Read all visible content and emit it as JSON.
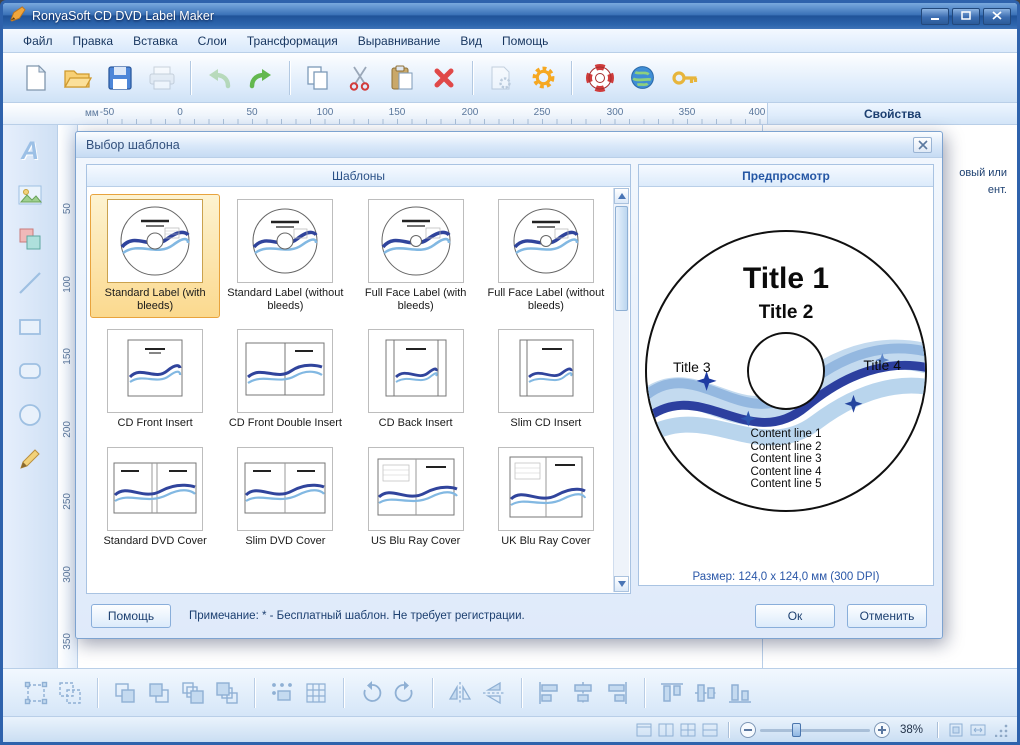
{
  "window": {
    "title": "RonyaSoft CD DVD Label Maker"
  },
  "menu": {
    "items": [
      "Файл",
      "Правка",
      "Вставка",
      "Слои",
      "Трансформация",
      "Выравнивание",
      "Вид",
      "Помощь"
    ]
  },
  "ruler": {
    "unit": "мм",
    "h_ticks": [
      "-50",
      "0",
      "50",
      "100",
      "150",
      "200",
      "250",
      "300",
      "350",
      "400"
    ],
    "v_ticks": [
      "50",
      "100",
      "150",
      "200",
      "250",
      "300",
      "350"
    ]
  },
  "properties": {
    "title": "Свойства",
    "visible_fragments": [
      "овый или",
      "ент."
    ]
  },
  "tools": {
    "text_tool_glyph": "A"
  },
  "dialog": {
    "title": "Выбор шаблона",
    "templates_header": "Шаблоны",
    "preview_header": "Предпросмотр",
    "templates": [
      {
        "label": "Standard Label (with bleeds)",
        "selected": true
      },
      {
        "label": "Standard Label (without bleeds)",
        "selected": false
      },
      {
        "label": "Full Face Label (with bleeds)",
        "selected": false
      },
      {
        "label": "Full Face Label (without bleeds)",
        "selected": false
      },
      {
        "label": "CD Front Insert",
        "selected": false
      },
      {
        "label": "CD Front Double Insert",
        "selected": false
      },
      {
        "label": "CD Back Insert",
        "selected": false
      },
      {
        "label": "Slim CD Insert",
        "selected": false
      },
      {
        "label": "Standard DVD Cover",
        "selected": false
      },
      {
        "label": "Slim DVD Cover",
        "selected": false
      },
      {
        "label": "US Blu Ray Cover",
        "selected": false
      },
      {
        "label": "UK Blu Ray Cover",
        "selected": false
      }
    ],
    "preview": {
      "title1": "Title 1",
      "title2": "Title 2",
      "title3": "Title 3",
      "title4": "Title 4",
      "content_lines": [
        "Content line 1",
        "Content line 2",
        "Content line 3",
        "Content line 4",
        "Content line 5"
      ],
      "size_label": "Размер: 124,0 x 124,0 мм (300 DPI)"
    },
    "note": "Примечание: * - Бесплатный шаблон. Не требует регистрации.",
    "buttons": {
      "help": "Помощь",
      "ok": "Ок",
      "cancel": "Отменить"
    }
  },
  "statusbar": {
    "zoom": "38%"
  }
}
